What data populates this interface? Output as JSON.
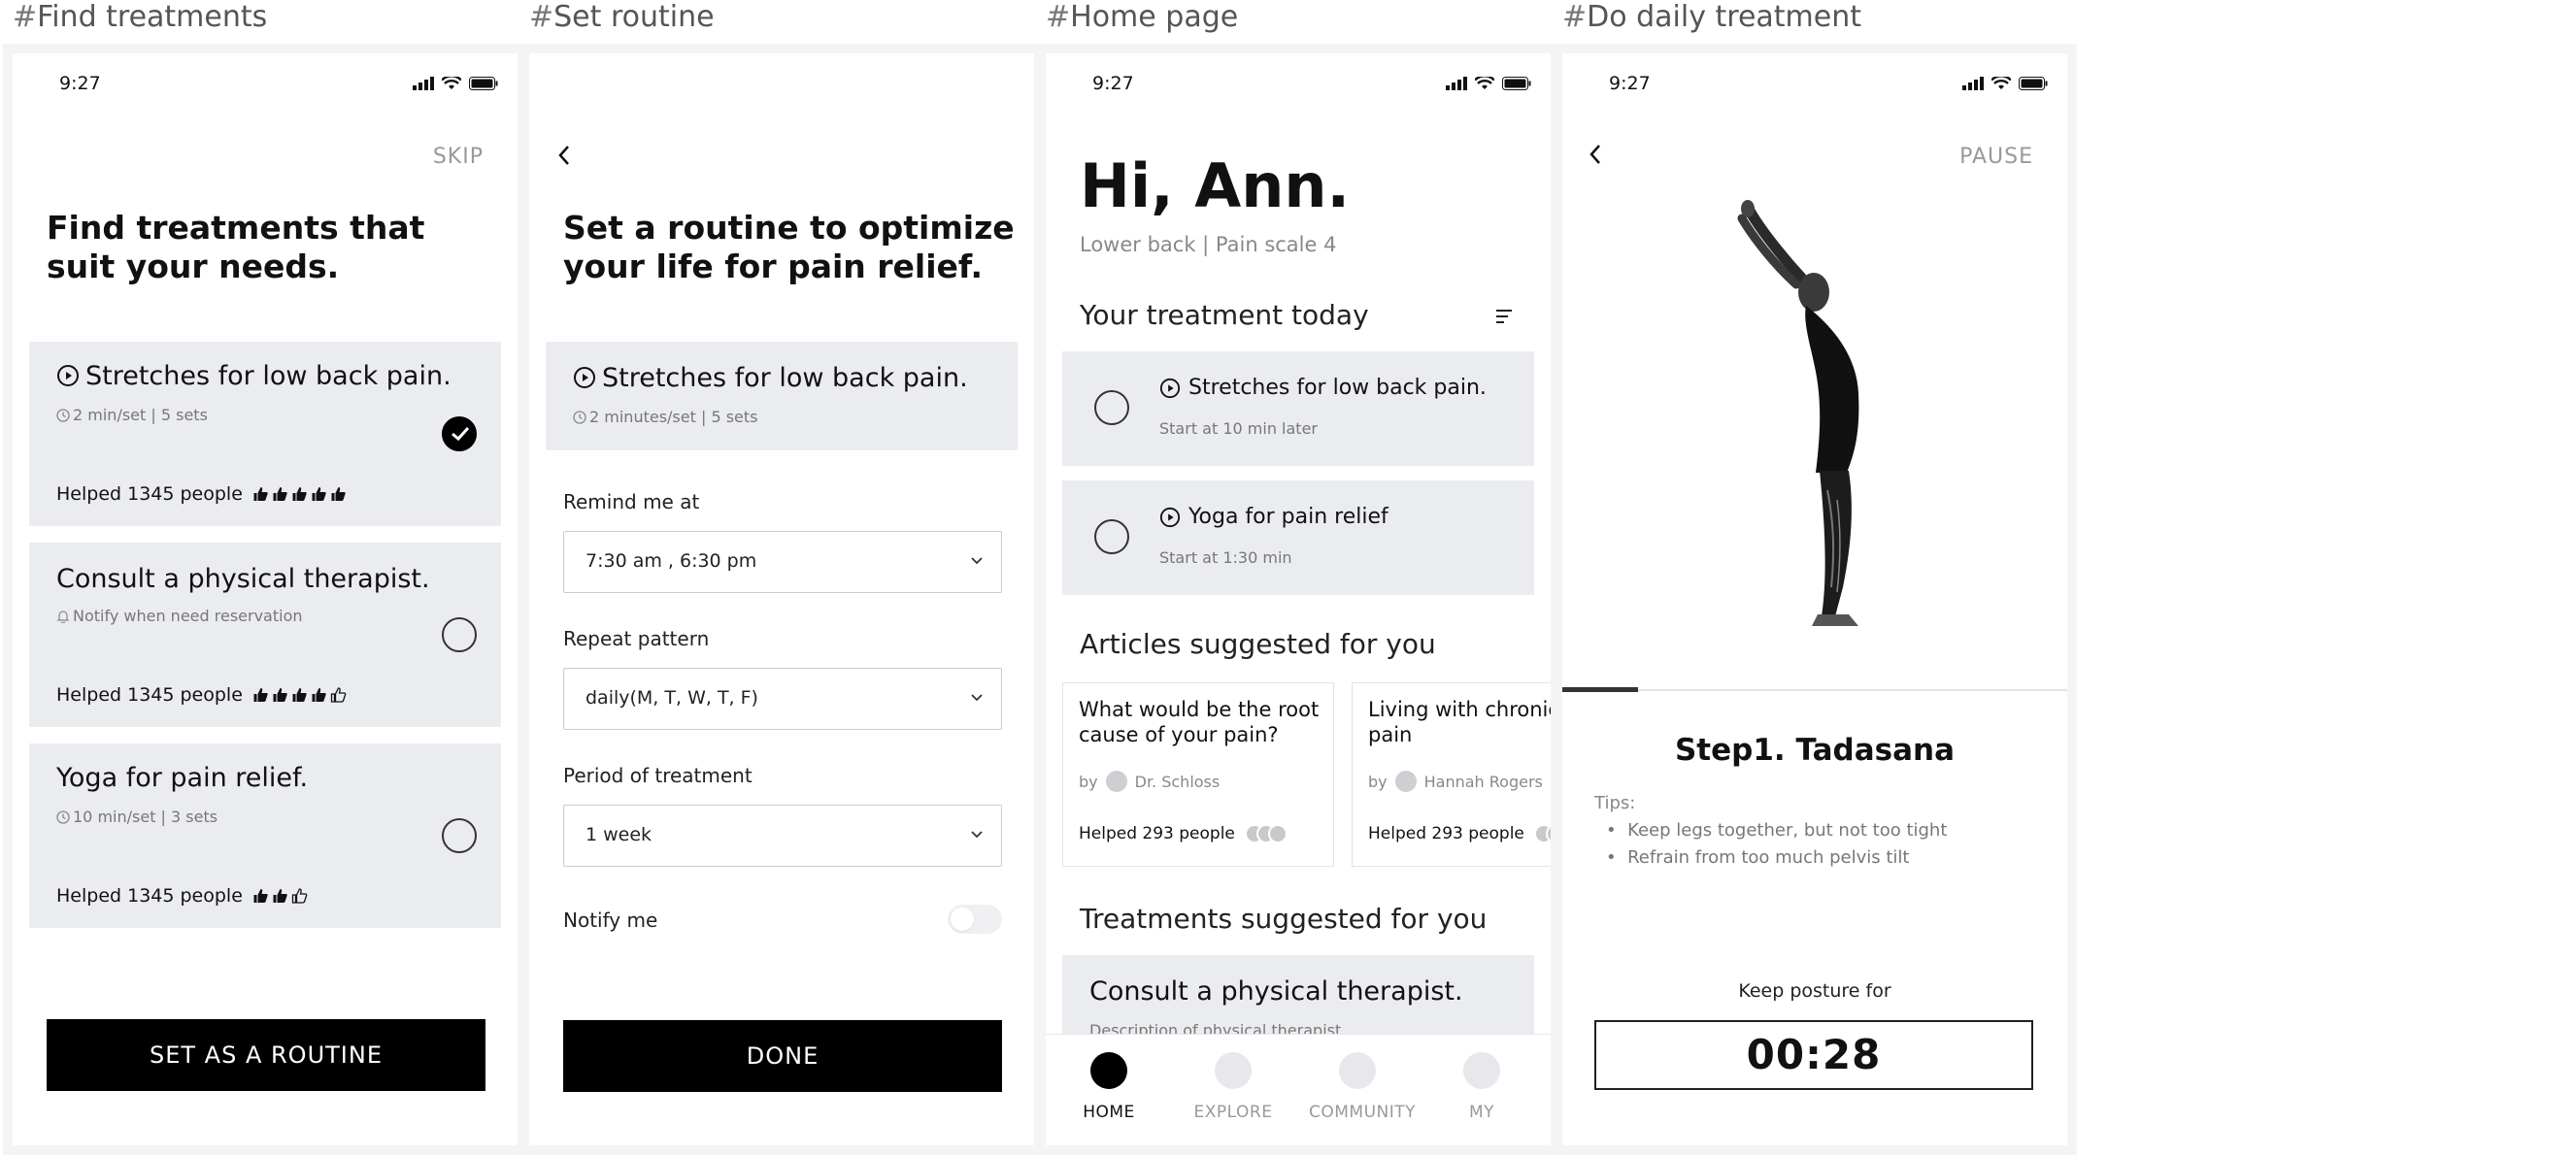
{
  "frames": {
    "find": {
      "label": "Find treatments"
    },
    "routine": {
      "label": "Set routine"
    },
    "home": {
      "label": "Home page"
    },
    "daily": {
      "label": "Do daily treatment"
    }
  },
  "status": {
    "time": "9:27"
  },
  "find": {
    "skip_label": "SKIP",
    "title": "Find treatments that suit your needs.",
    "cards": [
      {
        "title": "Stretches for low back pain.",
        "meta": "2 min/set  |  5 sets",
        "helped": "Helped 1345 people",
        "rating": 5,
        "selected": true
      },
      {
        "title": "Consult a physical therapist.",
        "meta": "Notify when need reservation",
        "helped": "Helped 1345 people",
        "rating": 4,
        "selected": false
      },
      {
        "title": "Yoga for pain relief.",
        "meta": "10 min/set  |  3 sets",
        "helped": "Helped 1345 people",
        "rating": 2,
        "selected": false
      }
    ],
    "cta_label": "SET AS A ROUTINE"
  },
  "routine": {
    "title": "Set a routine to optimize your life for pain relief.",
    "card": {
      "title": "Stretches for low back pain.",
      "meta": "2 minutes/set  |  5 sets"
    },
    "remind_label": "Remind me at",
    "remind_value": "7:30 am , 6:30 pm",
    "repeat_label": "Repeat pattern",
    "repeat_value": "daily(M, T, W, T, F)",
    "period_label": "Period of treatment",
    "period_value": "1 week",
    "notify_label": "Notify me",
    "notify_on": false,
    "done_label": "DONE"
  },
  "home": {
    "greeting": "Hi, Ann.",
    "subtitle": "Lower back | Pain scale 4",
    "today_heading": "Your treatment today",
    "today": [
      {
        "title": "Stretches for low back pain.",
        "sub": "Start at 10 min later"
      },
      {
        "title": "Yoga for pain relief",
        "sub": "Start at 1:30 min"
      }
    ],
    "articles_heading": "Articles suggested for you",
    "articles": [
      {
        "title": "What would be the root cause of your pain?",
        "by": "by",
        "author": "Dr. Schloss",
        "helped": "Helped 293 people"
      },
      {
        "title": "Living with chronic back pain",
        "by": "by",
        "author": "Hannah Rogers",
        "helped": "Helped 293 people"
      }
    ],
    "treat_heading": "Treatments suggested for you",
    "treat_card": {
      "title": "Consult a physical therapist.",
      "sub": "Description of physical therapist"
    },
    "tabs": [
      {
        "label": "HOME",
        "active": true
      },
      {
        "label": "EXPLORE",
        "active": false
      },
      {
        "label": "COMMUNITY",
        "active": false
      },
      {
        "label": "MY",
        "active": false
      }
    ]
  },
  "daily": {
    "pause_label": "PAUSE",
    "progress_fraction": 0.15,
    "step_title": "Step1. Tadasana",
    "tips_label": "Tips:",
    "tips": [
      "Keep legs together, but not too tight",
      "Refrain from too much pelvis tilt"
    ],
    "keep_label": "Keep posture for",
    "timer": "00:28"
  }
}
